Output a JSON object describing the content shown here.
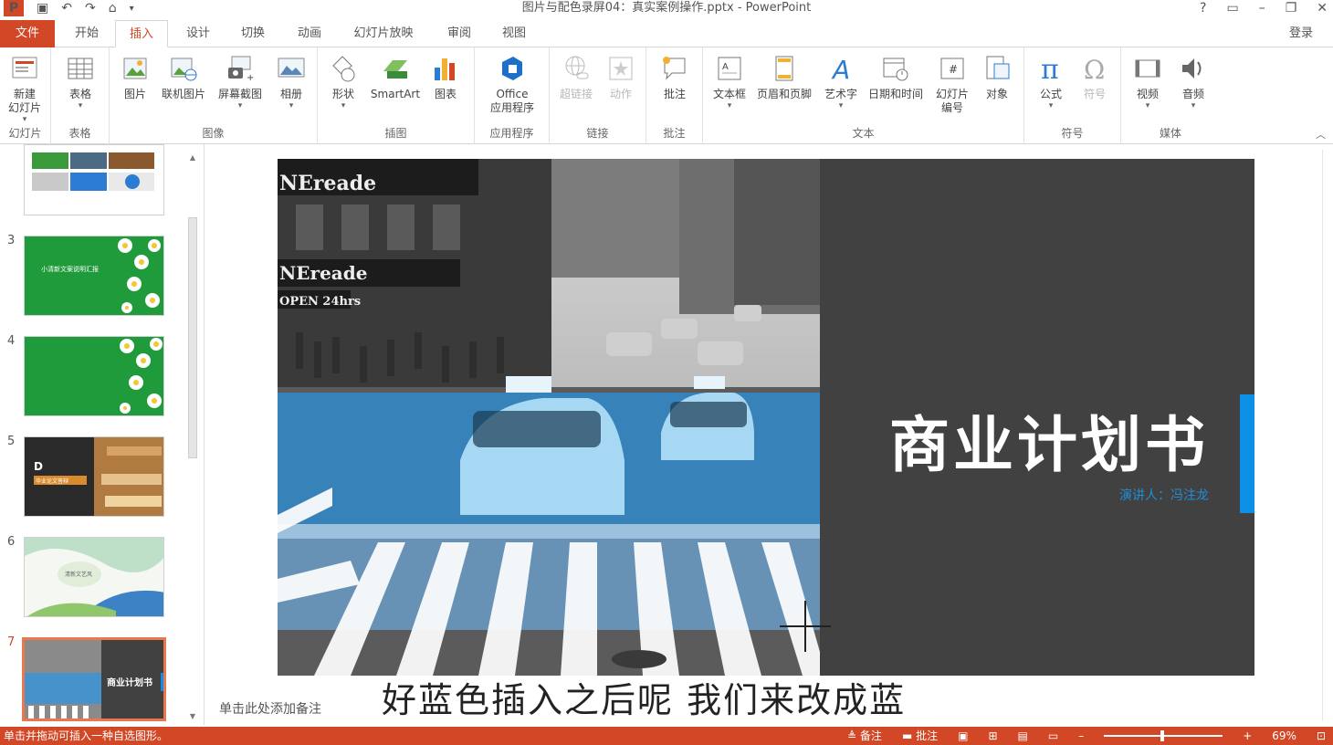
{
  "app": {
    "window_title": "图片与配色录屏04：真实案例操作.pptx - PowerPoint",
    "login": "登录",
    "win_controls": [
      "?",
      "▭",
      "–",
      "❐",
      "✕"
    ]
  },
  "tabs": [
    "文件",
    "开始",
    "插入",
    "设计",
    "切换",
    "动画",
    "幻灯片放映",
    "审阅",
    "视图"
  ],
  "ribbon": {
    "groups": [
      {
        "label": "幻灯片",
        "items": [
          {
            "label": "新建\n幻灯片",
            "icon": "new-slide-icon"
          }
        ]
      },
      {
        "label": "表格",
        "items": [
          {
            "label": "表格",
            "icon": "table-icon"
          }
        ]
      },
      {
        "label": "图像",
        "items": [
          {
            "label": "图片",
            "icon": "picture-icon"
          },
          {
            "label": "联机图片",
            "icon": "online-picture-icon"
          },
          {
            "label": "屏幕截图",
            "icon": "screenshot-icon"
          },
          {
            "label": "相册",
            "icon": "photo-album-icon"
          }
        ]
      },
      {
        "label": "插图",
        "items": [
          {
            "label": "形状",
            "icon": "shapes-icon"
          },
          {
            "label": "SmartArt",
            "icon": "smartart-icon"
          },
          {
            "label": "图表",
            "icon": "chart-icon"
          }
        ]
      },
      {
        "label": "应用程序",
        "items": [
          {
            "label": "Office\n应用程序",
            "icon": "office-apps-icon"
          }
        ]
      },
      {
        "label": "链接",
        "items": [
          {
            "label": "超链接",
            "icon": "hyperlink-icon"
          },
          {
            "label": "动作",
            "icon": "action-icon"
          }
        ]
      },
      {
        "label": "批注",
        "items": [
          {
            "label": "批注",
            "icon": "comment-icon"
          }
        ]
      },
      {
        "label": "文本",
        "items": [
          {
            "label": "文本框",
            "icon": "textbox-icon"
          },
          {
            "label": "页眉和页脚",
            "icon": "header-footer-icon"
          },
          {
            "label": "艺术字",
            "icon": "wordart-icon"
          },
          {
            "label": "日期和时间",
            "icon": "date-time-icon"
          },
          {
            "label": "幻灯片\n编号",
            "icon": "slide-number-icon"
          },
          {
            "label": "对象",
            "icon": "object-icon"
          }
        ]
      },
      {
        "label": "符号",
        "items": [
          {
            "label": "公式",
            "icon": "equation-icon"
          },
          {
            "label": "符号",
            "icon": "symbol-icon"
          }
        ]
      },
      {
        "label": "媒体",
        "items": [
          {
            "label": "视频",
            "icon": "video-icon"
          },
          {
            "label": "音频",
            "icon": "audio-icon"
          }
        ]
      }
    ]
  },
  "thumbnails": [
    {
      "num": "",
      "theme": "mixed"
    },
    {
      "num": "3",
      "theme": "green-daisy",
      "text": "小清新文案说明汇报"
    },
    {
      "num": "4",
      "theme": "green-daisy-plain"
    },
    {
      "num": "5",
      "theme": "dark-wood",
      "text": "毕业论文答辩"
    },
    {
      "num": "6",
      "theme": "watercolor",
      "text": "清新文艺风"
    },
    {
      "num": "7",
      "theme": "business-plan",
      "text": "商业计划书",
      "selected": true
    }
  ],
  "slide": {
    "title": "商业计划书",
    "subtitle": "演讲人：冯注龙",
    "accent": "#0c8fe6",
    "panel_color": "#414141",
    "photo_texts": [
      "NEreade",
      "NEreade",
      "OPEN 24hrs"
    ]
  },
  "notes_placeholder": "单击此处添加备注",
  "video_subtitle": "好蓝色插入之后呢 我们来改成蓝",
  "status": {
    "hint": "单击并拖动可插入一种自选图形。",
    "notes": "备注",
    "comments": "批注",
    "zoom": "69%"
  },
  "colors": {
    "brand": "#d24726",
    "blue_overlay": "#2b8fd8"
  }
}
